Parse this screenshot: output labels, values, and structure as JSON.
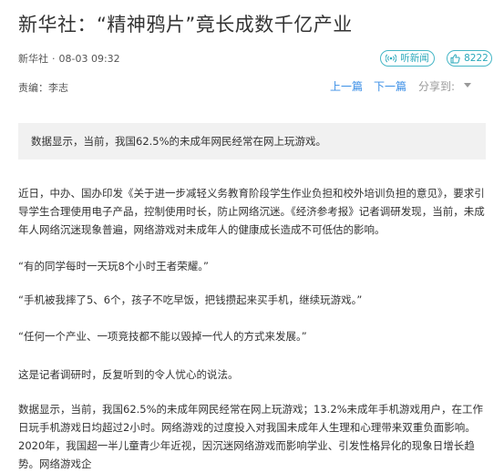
{
  "article": {
    "title": "新华社：“精神鸦片”竟长成数千亿产业",
    "source": "新华社",
    "separator": "·",
    "datetime": "08-03 09:32",
    "listen_label": "听新闻",
    "like_count": "8222",
    "editor": "责编：李志",
    "prev_label": "上一篇",
    "next_label": "下一篇",
    "share_label": "分享到:",
    "summary": "数据显示，当前，我国62.5%的未成年网民经常在网上玩游戏。",
    "paragraphs": [
      "近日，中办、国办印发《关于进一步减轻义务教育阶段学生作业负担和校外培训负担的意见》，要求引导学生合理使用电子产品，控制使用时长，防止网络沉迷。《经济参考报》记者调研发现，当前，未成年人网络沉迷现象普遍，网络游戏对未成年人的健康成长造成不可低估的影响。",
      "“有的同学每时一天玩8个小时王者荣耀。”",
      "“手机被我摔了5、6个，孩子不吃早饭，把钱攒起来买手机，继续玩游戏。”",
      "“任何一个产业、一项竞技都不能以毁掉一代人的方式来发展。”",
      "这是记者调研时，反复听到的令人忧心的说法。",
      "数据显示，当前，我国62.5%的未成年网民经常在网上玩游戏；13.2%未成年手机游戏用户，在工作日玩手机游戏日均超过2小时。网络游戏的过度投入对我国未成年人生理和心理带来双重负面影响。2020年，我国超一半儿童青少年近视，因沉迷网络游戏而影响学业、引发性格异化的现象日增长趋势。网络游戏企"
    ]
  },
  "colors": {
    "accent_teal": "#2aa8bb",
    "link_blue": "#3a8ee6",
    "summary_bg": "#f1f1f1"
  },
  "icons": {
    "listen": "broadcast-icon",
    "like": "thumbs-up-icon",
    "share": "caret-down-icon"
  }
}
